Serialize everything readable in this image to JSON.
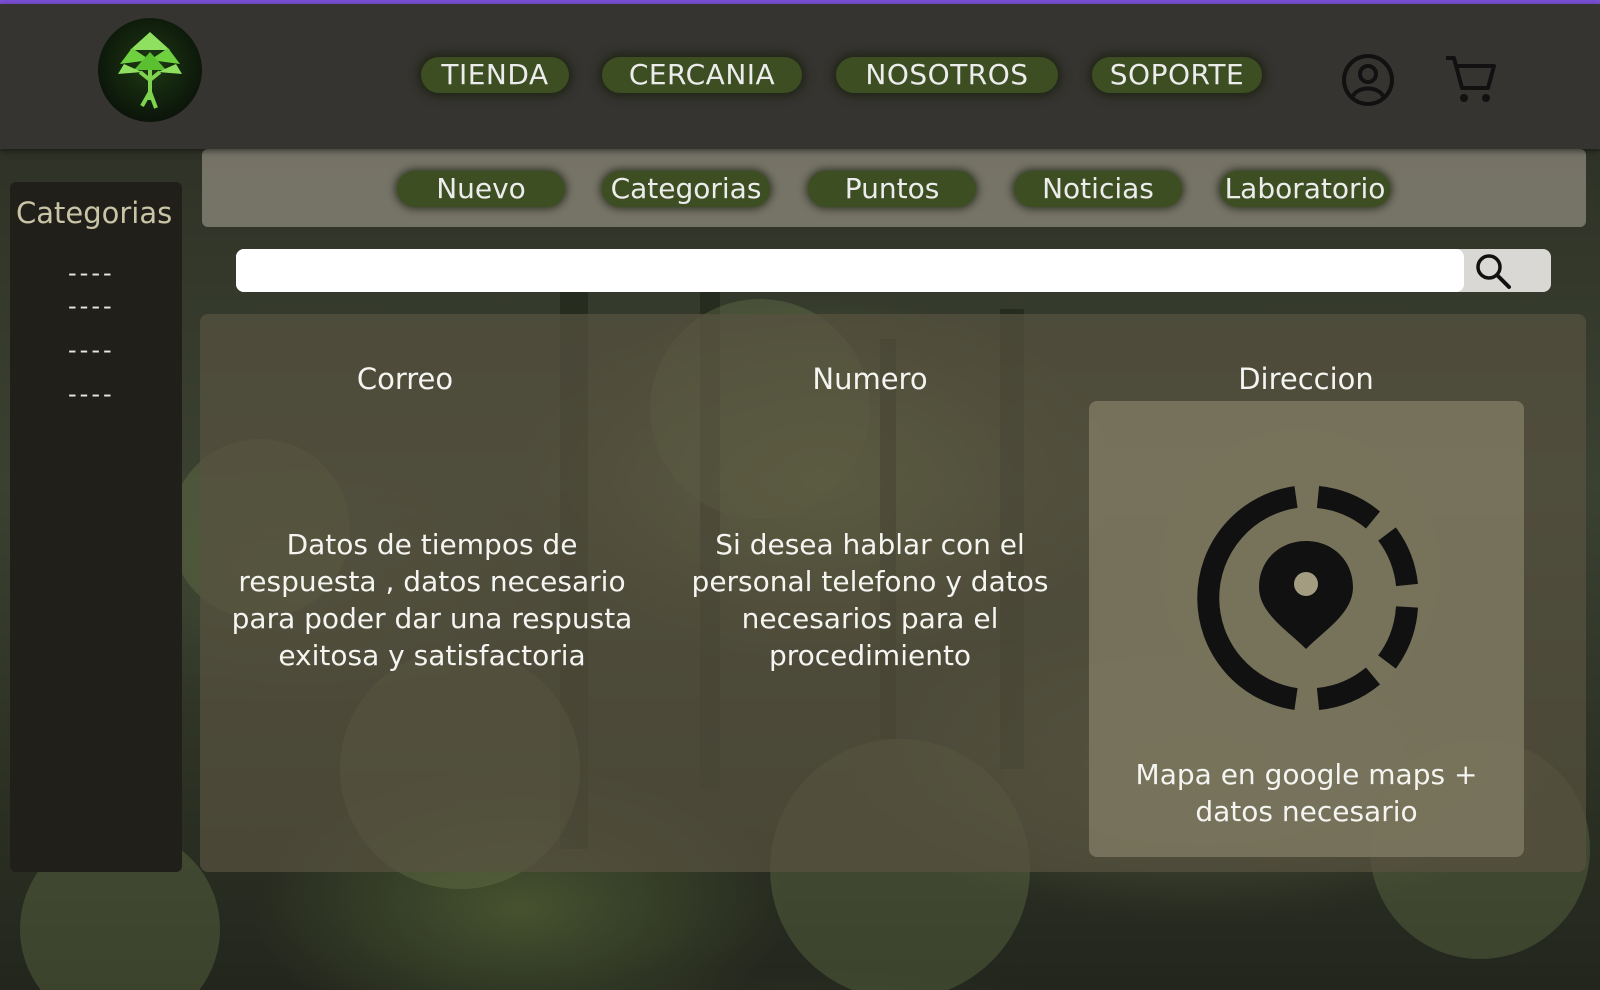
{
  "header": {
    "nav": [
      {
        "label": "TIENDA"
      },
      {
        "label": "CERCANIA"
      },
      {
        "label": "NOSOTROS"
      },
      {
        "label": "SOPORTE"
      }
    ],
    "icons": {
      "account": "user-circle-icon",
      "cart": "shopping-cart-icon",
      "logo": "tree-logo"
    }
  },
  "sidebar": {
    "title": "Categorias",
    "items": [
      "----",
      "----",
      "----",
      "----"
    ]
  },
  "subnav": {
    "items": [
      {
        "label": "Nuevo"
      },
      {
        "label": "Categorias"
      },
      {
        "label": "Puntos"
      },
      {
        "label": "Noticias"
      },
      {
        "label": "Laboratorio"
      }
    ]
  },
  "search": {
    "placeholder": "",
    "value": "",
    "icon": "search-icon"
  },
  "contact": {
    "email": {
      "title": "Correo",
      "text": "Datos de tiempos de respuesta , datos necesario para poder dar una respusta exitosa y satisfactoria"
    },
    "phone": {
      "title": "Numero",
      "text": "Si desea hablar con el personal telefono y datos necesarios para el procedimiento"
    },
    "address": {
      "title": "Direccion",
      "map_text": "Mapa en google maps + datos necesario",
      "icon": "location-pin-icon"
    }
  },
  "colors": {
    "accent": "#7b4fd6",
    "pill": "#3d4f22",
    "header": "#363431"
  }
}
